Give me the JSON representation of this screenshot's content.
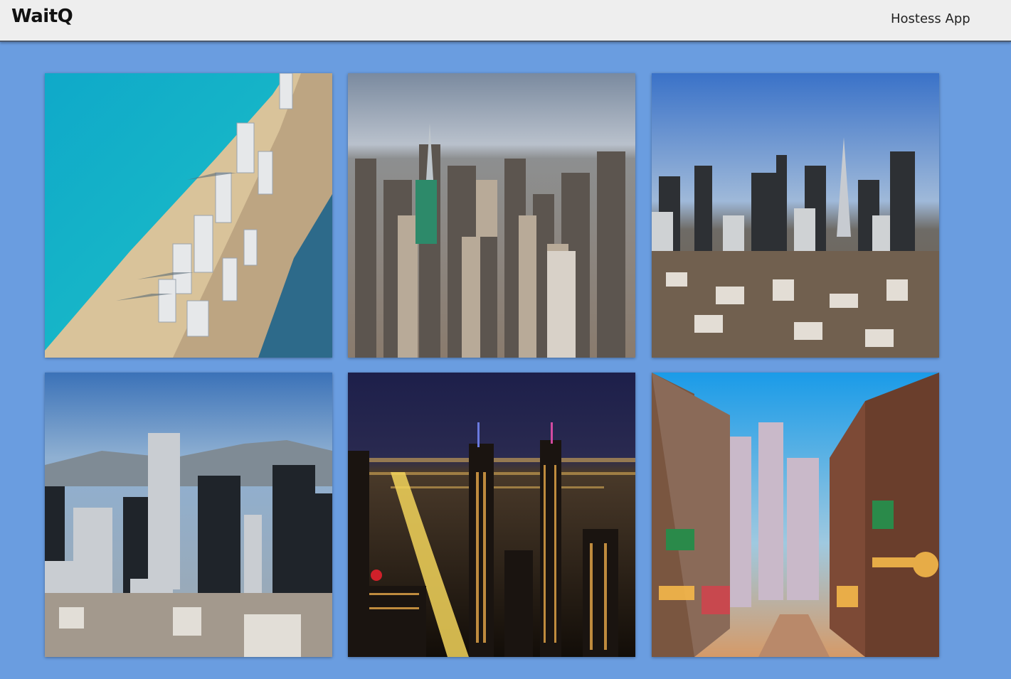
{
  "header": {
    "brand": "WaitQ",
    "nav_link": "Hostess App"
  },
  "cities": [
    {
      "image": "miami-beach-aerial-photo"
    },
    {
      "image": "new-york-manhattan-aerial-photo"
    },
    {
      "image": "san-francisco-skyline-photo"
    },
    {
      "image": "los-angeles-downtown-photo"
    },
    {
      "image": "chicago-night-skyline-photo"
    },
    {
      "image": "new-orleans-bourbon-street-photo"
    }
  ]
}
